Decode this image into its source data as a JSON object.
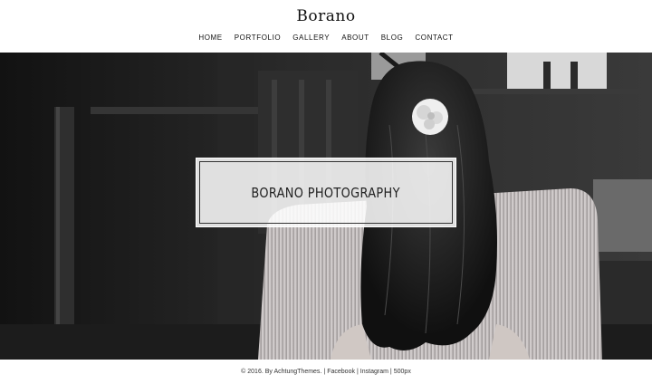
{
  "site": {
    "title": "Borano"
  },
  "nav": {
    "items": [
      {
        "label": "HOME"
      },
      {
        "label": "PORTFOLIO"
      },
      {
        "label": "GALLERY"
      },
      {
        "label": "ABOUT"
      },
      {
        "label": "BLOG"
      },
      {
        "label": "CONTACT"
      }
    ]
  },
  "hero": {
    "title": "BORANO PHOTOGRAPHY"
  },
  "footer": {
    "copyright": "© 2016. By AchtungThemes.",
    "links": [
      "Facebook",
      "Instagram",
      "500px"
    ],
    "separator": "|"
  }
}
